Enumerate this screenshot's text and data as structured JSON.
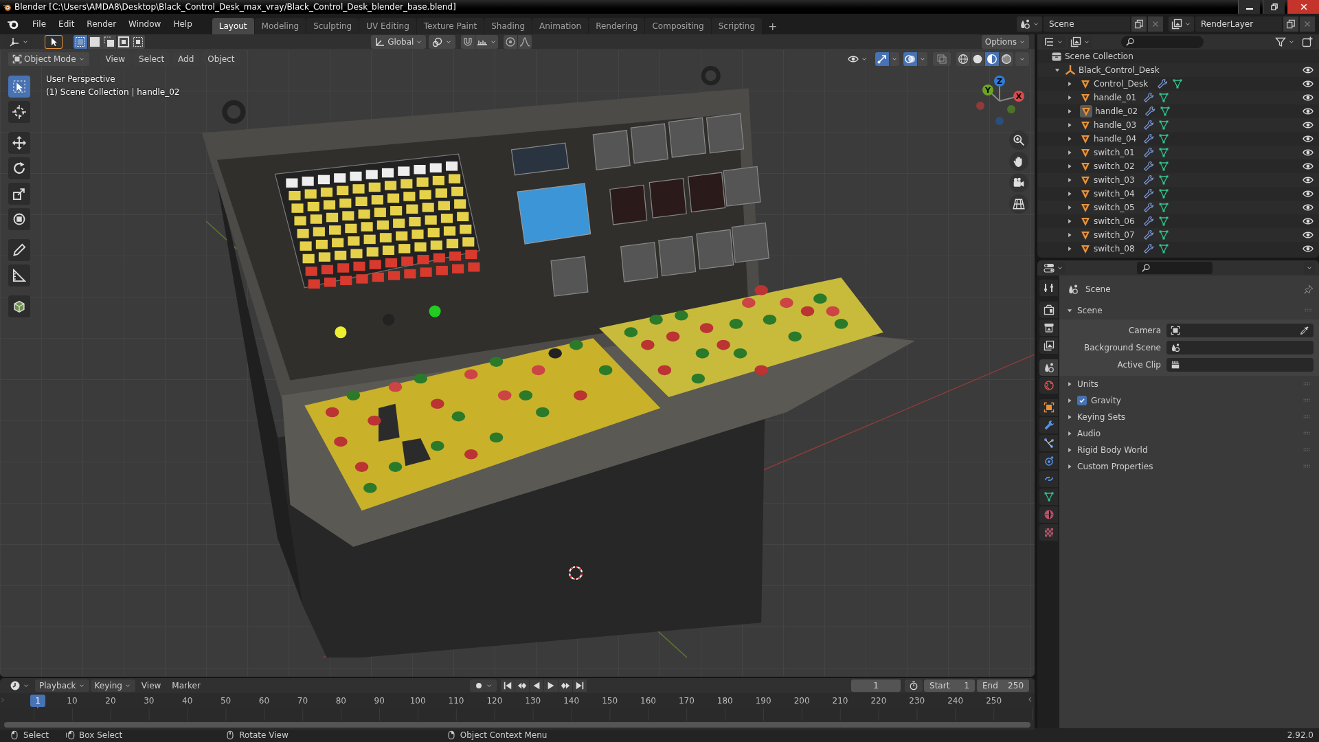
{
  "window": {
    "title": "Blender [C:\\Users\\AMDA8\\Desktop\\Black_Control_Desk_max_vray/Black_Control_Desk_blender_base.blend]"
  },
  "menu": [
    "File",
    "Edit",
    "Render",
    "Window",
    "Help"
  ],
  "workspaces": [
    {
      "label": "Layout",
      "selected": true
    },
    {
      "label": "Modeling",
      "selected": false
    },
    {
      "label": "Sculpting",
      "selected": false
    },
    {
      "label": "UV Editing",
      "selected": false
    },
    {
      "label": "Texture Paint",
      "selected": false
    },
    {
      "label": "Shading",
      "selected": false
    },
    {
      "label": "Animation",
      "selected": false
    },
    {
      "label": "Rendering",
      "selected": false
    },
    {
      "label": "Compositing",
      "selected": false
    },
    {
      "label": "Scripting",
      "selected": false
    }
  ],
  "add_workspace": "+",
  "scene_selector": {
    "value": "Scene"
  },
  "view_layer_selector": {
    "value": "RenderLayer"
  },
  "viewport": {
    "header": {
      "select_modes": [
        {
          "selected": true
        },
        {
          "selected": false
        },
        {
          "selected": false
        },
        {
          "selected": false
        },
        {
          "selected": false
        }
      ],
      "orientation": "Global",
      "options": "Options",
      "mode": "Object Mode",
      "menus": [
        "View",
        "Select",
        "Add",
        "Object"
      ],
      "gizmos_on": true,
      "overlays_on": true,
      "xray_on": false,
      "shading": [
        {
          "kind": "wireframe",
          "selected": false
        },
        {
          "kind": "solid",
          "selected": false
        },
        {
          "kind": "material",
          "selected": true
        },
        {
          "kind": "rendered",
          "selected": false
        }
      ]
    },
    "info": [
      "User Perspective",
      "(1) Scene Collection | handle_02"
    ],
    "tools": [
      {
        "kind": "select",
        "selected": true
      },
      {
        "kind": "cursor",
        "selected": false
      },
      {
        "kind": "move",
        "selected": false
      },
      {
        "kind": "rotate",
        "selected": false
      },
      {
        "kind": "scale",
        "selected": false
      },
      {
        "kind": "transform",
        "selected": false
      },
      {
        "kind": "annotate",
        "selected": false
      },
      {
        "kind": "measure",
        "selected": false
      },
      {
        "kind": "add_cube",
        "selected": false
      }
    ],
    "gizmo_axes": [
      "Z",
      "Y",
      "X"
    ]
  },
  "outliner": {
    "root": "Scene Collection",
    "collection": {
      "name": "Black_Control_Desk",
      "expanded": true,
      "children": [
        {
          "name": "Control_Desk",
          "expanded": false,
          "active": false
        },
        {
          "name": "handle_01",
          "expanded": false,
          "active": false
        },
        {
          "name": "handle_02",
          "expanded": false,
          "active": true
        },
        {
          "name": "handle_03",
          "expanded": false,
          "active": false
        },
        {
          "name": "handle_04",
          "expanded": false,
          "active": false
        },
        {
          "name": "switch_01",
          "expanded": false,
          "active": false
        },
        {
          "name": "switch_02",
          "expanded": false,
          "active": false
        },
        {
          "name": "switch_03",
          "expanded": false,
          "active": false
        },
        {
          "name": "switch_04",
          "expanded": false,
          "active": false
        },
        {
          "name": "switch_05",
          "expanded": false,
          "active": false
        },
        {
          "name": "switch_06",
          "expanded": false,
          "active": false
        },
        {
          "name": "switch_07",
          "expanded": false,
          "active": false
        },
        {
          "name": "switch_08",
          "expanded": false,
          "active": false
        }
      ]
    }
  },
  "properties": {
    "context": "Scene",
    "tabs": [
      {
        "kind": "tool",
        "selected": false
      },
      {
        "kind": "render",
        "selected": false
      },
      {
        "kind": "output",
        "selected": false
      },
      {
        "kind": "view_layer",
        "selected": false
      },
      {
        "kind": "scene",
        "selected": true
      },
      {
        "kind": "world",
        "selected": false
      },
      {
        "kind": "object",
        "selected": false
      },
      {
        "kind": "modifiers",
        "selected": false
      },
      {
        "kind": "particles",
        "selected": false
      },
      {
        "kind": "physics",
        "selected": false
      },
      {
        "kind": "constraints",
        "selected": false
      },
      {
        "kind": "data",
        "selected": false
      },
      {
        "kind": "material",
        "selected": false
      },
      {
        "kind": "texture",
        "selected": false
      }
    ],
    "panel": {
      "title": "Scene",
      "expanded": true,
      "fields": [
        {
          "kind": "object",
          "label": "Camera"
        },
        {
          "kind": "scene",
          "label": "Background Scene"
        },
        {
          "kind": "clip",
          "label": "Active Clip"
        }
      ]
    },
    "subpanels": [
      {
        "title": "Units",
        "expanded": false
      },
      {
        "title": "Gravity",
        "expanded": false,
        "checked": true
      },
      {
        "title": "Keying Sets",
        "expanded": false
      },
      {
        "title": "Audio",
        "expanded": false
      },
      {
        "title": "Rigid Body World",
        "expanded": false
      },
      {
        "title": "Custom Properties",
        "expanded": false
      }
    ]
  },
  "timeline": {
    "menus": [
      "Playback",
      "Keying",
      "View",
      "Marker"
    ],
    "current_frame": "1",
    "start": {
      "label": "Start",
      "value": "1"
    },
    "end": {
      "label": "End",
      "value": "250"
    },
    "playhead": "1",
    "ruler": [
      "10",
      "20",
      "30",
      "40",
      "50",
      "60",
      "70",
      "80",
      "90",
      "100",
      "110",
      "120",
      "130",
      "140",
      "150",
      "160",
      "170",
      "180",
      "190",
      "200",
      "210",
      "220",
      "230",
      "240",
      "250"
    ]
  },
  "status_bar": {
    "hints": [
      "Select",
      "Box Select",
      "Rotate View",
      "Object Context Menu"
    ],
    "version": "2.92.0"
  }
}
